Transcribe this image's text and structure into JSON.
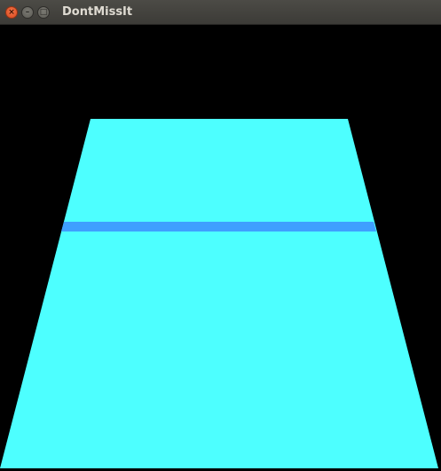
{
  "window": {
    "title": "DontMissIt",
    "close_glyph": "×",
    "minimize_glyph": "–",
    "maximize_glyph": "□"
  },
  "game": {
    "background_color": "#000000",
    "track_color": "#4dffff",
    "bar_color": "#3f9fff"
  }
}
